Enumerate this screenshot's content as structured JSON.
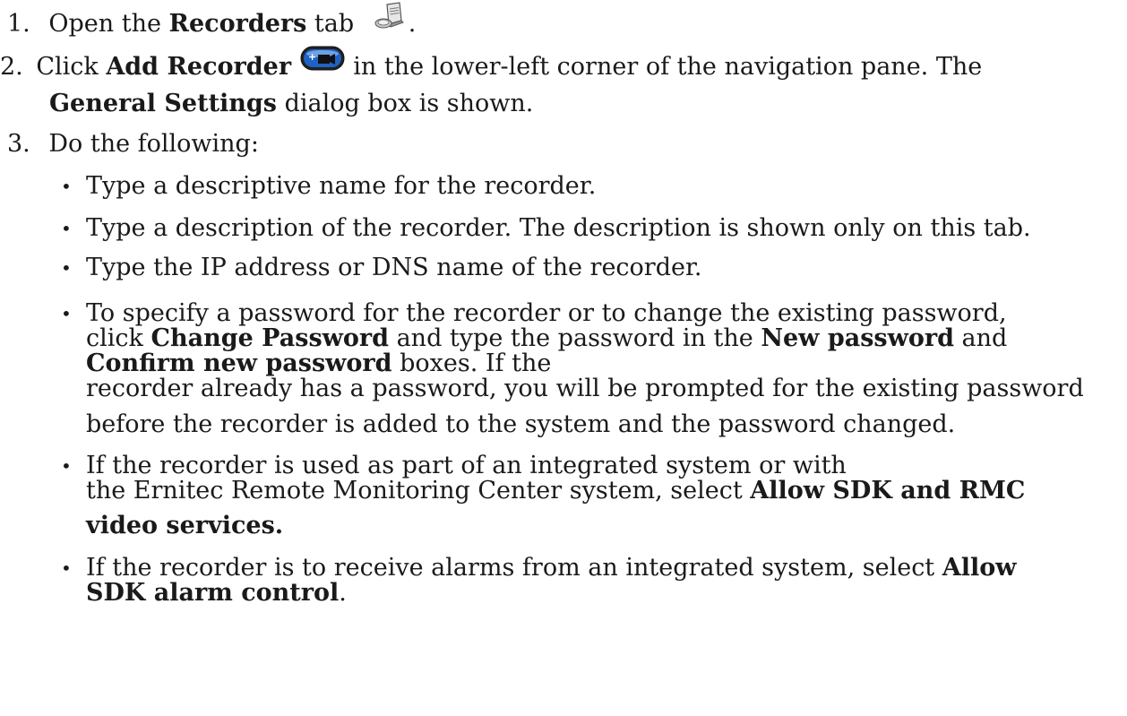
{
  "steps": [
    {
      "number": "1.",
      "pre": "Open the ",
      "bold": "Recorders",
      "post": " tab",
      "icon": "recorders-tab-icon",
      "end": "."
    },
    {
      "number": "2.",
      "pre": "Click ",
      "bold": "Add Recorder",
      "icon": "add-recorder-icon",
      "post": " in the lower-left corner of the navigation pane. The",
      "line2_bold": "General Settings",
      "line2_post": " dialog box is shown."
    },
    {
      "number": "3.",
      "text": "Do the following:"
    }
  ],
  "bullets": {
    "b1": "Type a descriptive name for the recorder.",
    "b2": "Type a description of the recorder. The description is shown only on this tab.",
    "b3": "Type the IP address or DNS name of the recorder.",
    "b4": {
      "l1": "To specify a password for the recorder or to change the existing password,",
      "l2_pre": "click ",
      "l2_bold1": "Change Password",
      "l2_mid": " and type the password in the ",
      "l2_bold2": "New password",
      "l2_post": " and",
      "l3_bold": "Confirm new password",
      "l3_post": " boxes. If the",
      "l4": "recorder already has a password, you will be prompted for the existing password",
      "l5": "before the recorder is added to the system and the password changed."
    },
    "b5": {
      "l1": "If the recorder is used as part of an integrated system or with",
      "l2_pre": "the Ernitec Remote Monitoring Center system, select ",
      "l2_bold": "Allow SDK and RMC",
      "l3_bold": "video services."
    },
    "b6": {
      "l1_pre": "If the recorder is to receive alarms from an integrated system, select ",
      "l1_bold": "Allow",
      "l2_bold": "SDK alarm control",
      "l2_post": "."
    }
  },
  "bullet_char": "•",
  "icons": {
    "recorders_tab": "recorders-tab-icon",
    "add_recorder": "add-recorder-icon",
    "accent_blue": "#1e63c4",
    "accent_dark": "#222222"
  }
}
